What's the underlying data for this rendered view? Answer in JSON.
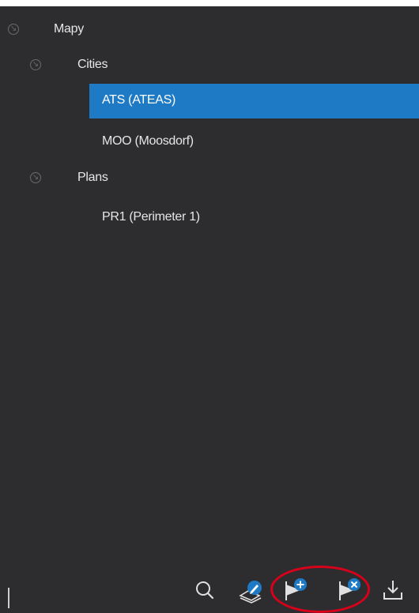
{
  "tree": {
    "root": {
      "label": "Mapy"
    },
    "groups": [
      {
        "label": "Cities",
        "items": [
          {
            "label": "ATS (ATEAS)",
            "selected": true
          },
          {
            "label": "MOO (Moosdorf)",
            "selected": false
          }
        ]
      },
      {
        "label": "Plans",
        "items": [
          {
            "label": "PR1 (Perimeter 1)",
            "selected": false
          }
        ]
      }
    ]
  },
  "toolbar": {
    "icons": [
      "search-icon",
      "edit-layer-icon",
      "flag-add-icon",
      "flag-remove-icon",
      "download-icon"
    ]
  },
  "colors": {
    "panel_bg": "#2d2d30",
    "selection": "#1f7ac5",
    "icon_blue": "#1f7ac5",
    "annotation": "#d9001a"
  }
}
